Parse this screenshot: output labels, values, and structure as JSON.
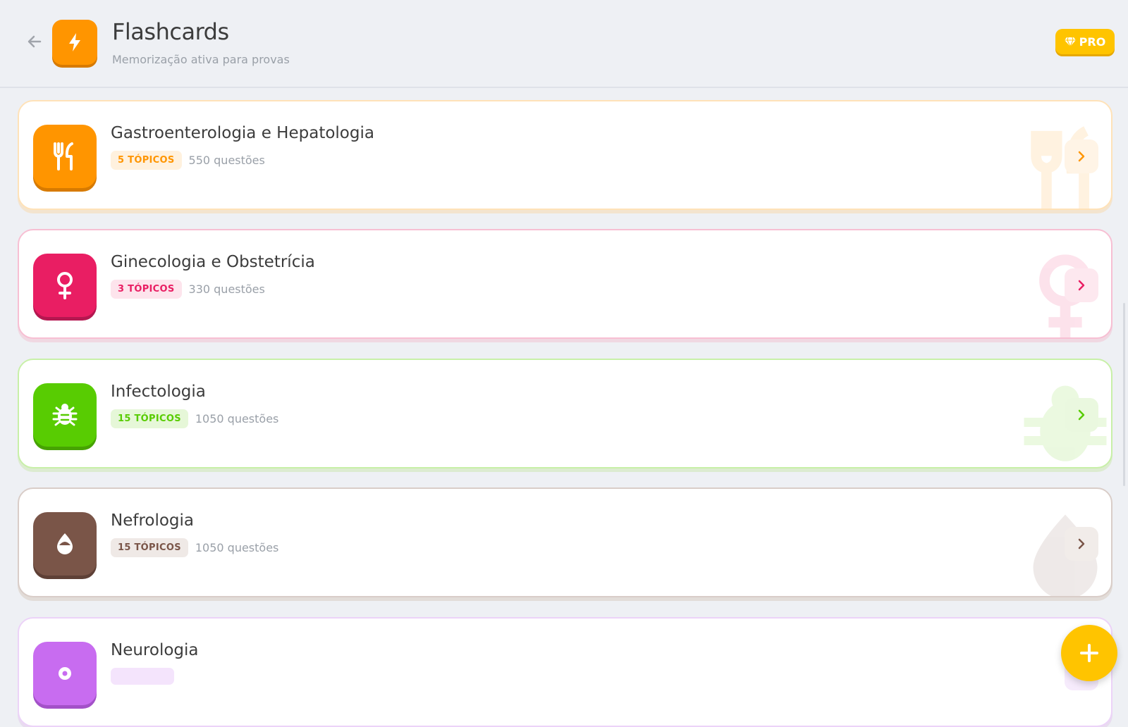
{
  "header": {
    "title": "Flashcards",
    "subtitle": "Memorização ativa para provas",
    "back_icon": "arrow-left-icon",
    "app_icon": "lightning-icon",
    "pro_label": "PRO",
    "pro_icon": "diamond-icon",
    "accent": "#ff9500"
  },
  "categories": [
    {
      "title": "Gastroenterologia e Hepatologia",
      "badge": "5 TÓPICOS",
      "questions": "550 questões",
      "icon": "fork-knife-icon",
      "color": "#ff9500"
    },
    {
      "title": "Ginecologia e Obstetrícia",
      "badge": "3 TÓPICOS",
      "questions": "330 questões",
      "icon": "female-symbol-icon",
      "color": "#e91e63"
    },
    {
      "title": "Infectologia",
      "badge": "15 TÓPICOS",
      "questions": "1050 questões",
      "icon": "bug-icon",
      "color": "#58cc02"
    },
    {
      "title": "Nefrologia",
      "badge": "15 TÓPICOS",
      "questions": "1050 questões",
      "icon": "drop-icon",
      "color": "#7a5548"
    },
    {
      "title": "Neurologia",
      "badge": "",
      "questions": "",
      "icon": "brain-icon",
      "color": "#c86cf0"
    }
  ],
  "fab": {
    "icon": "plus-icon",
    "color": "#ffc400"
  }
}
